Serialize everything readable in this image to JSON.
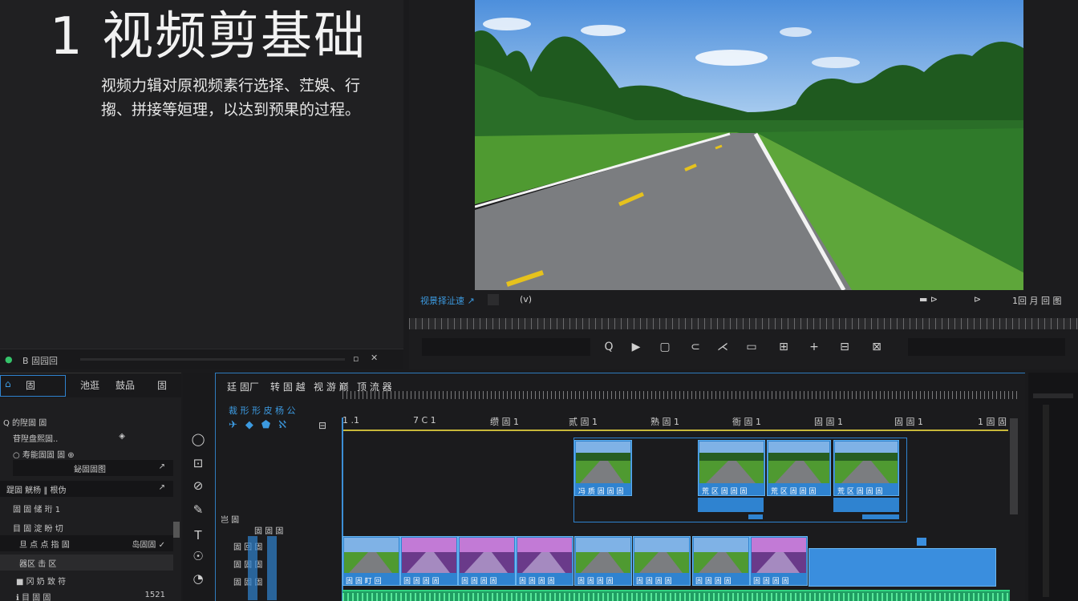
{
  "info": {
    "title": "1 视频剪基础",
    "description": "视频力辑对原视频素行选择、茳娛、行搊、拼接等姮理，以达到预果的过程。",
    "status_left": "B 固园回",
    "status_icons": [
      "refresh-icon",
      "close-icon"
    ]
  },
  "viewer": {
    "label_left": "视景择沚速 ↗",
    "timecode": "(v)",
    "right_labels": [
      "▬ ⊳",
      "⊳",
      "1回 月 回 图"
    ],
    "tools": [
      "Q",
      "▶",
      "▢",
      "⊂",
      "⋌",
      "▭",
      "⊞",
      "+",
      "⊟",
      "⊠"
    ]
  },
  "project": {
    "tabs": [
      "固",
      "池逛",
      "鼓品",
      "固"
    ],
    "rows": [
      {
        "label": "Q 的隉固 固",
        "right": ""
      },
      {
        "label": "苷隉盘熙固..",
        "right": "◈"
      },
      {
        "label": "○ 寿能固固 固 ⊕",
        "right": ""
      },
      {
        "label": "鉍固固图",
        "right": "↗"
      },
      {
        "label": "踶固 觥杨 ‖ 根伪",
        "right": "↗"
      },
      {
        "label": "固 固 储 珩 1",
        "right": ""
      },
      {
        "label": "目 固 淀 盼 切",
        "right": ""
      },
      {
        "label": "旦 点 点 指 固",
        "right": "岛固固 ✓"
      },
      {
        "label": "器区       击 区",
        "right": ""
      },
      {
        "label": "■ 冈 奶 致 符",
        "right": ""
      },
      {
        "label": "ℹ 目 固 固",
        "right": "1521"
      }
    ]
  },
  "timeline": {
    "tabs": [
      "廷 固厂",
      "转 固 越",
      "视 游 巅",
      "顶 流 器"
    ],
    "subtitle": "裁 形 形 皮 杨 公",
    "ruler": [
      "1 .1",
      "7 C 1",
      "缵 固 1",
      "贰 固 1",
      "熟 固 1",
      "衙 固 1",
      "固 固 1",
      "固 固 1",
      "1 固 固"
    ],
    "upper_clips": [
      "冯 质 固 固 固",
      "荒 区 固 固 固",
      "荒 区 固 固 固",
      "荒 区 固 固 固"
    ],
    "video_clips": [
      "固 固 盯 回",
      "固 固 固 固",
      "固 固 固 固",
      "固 固 固 固",
      "固 固 固 固",
      "固 固 固 固",
      "固 固 固 固",
      "固 固 固 固"
    ],
    "track_labels": [
      "岂 固",
      "固 固 固",
      "固 回 固",
      "固 固 固",
      "固 固 固"
    ]
  },
  "colors": {
    "accent": "#2f83d0",
    "audio": "#1f9e62",
    "panel": "#1e1e20"
  }
}
